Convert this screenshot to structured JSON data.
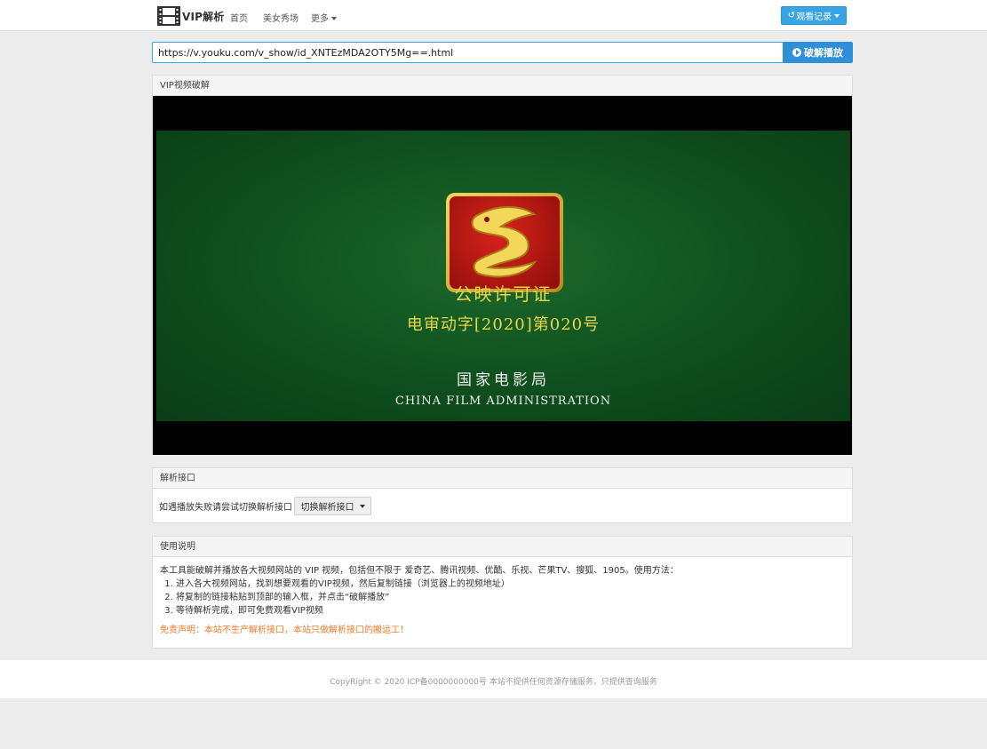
{
  "navbar": {
    "brand": "VIP解析",
    "links": [
      "首页",
      "美女秀场"
    ],
    "more": "更多",
    "history_button": "观看记录"
  },
  "search": {
    "url_value": "https://v.youku.com/v_show/id_XNTEzMDA2OTY5Mg==.html",
    "play_button": "破解播放"
  },
  "video_panel": {
    "title": "VIP视频破解",
    "frame_text": {
      "line1": "公映许可证",
      "line2": "电审动字[2020]第020号",
      "line3": "国家电影局",
      "line4": "CHINA FILM ADMINISTRATION"
    }
  },
  "api_panel": {
    "title": "解析接口",
    "hint": "如遇播放失败请尝试切换解析接口",
    "switch_button": "切换解析接口"
  },
  "help_panel": {
    "title": "使用说明",
    "intro": "本工具能破解并播放各大视频网站的 VIP 视频，包括但不限于 爱奇艺、腾讯视频、优酷、乐视、芒果TV、搜狐、1905。使用方法：",
    "steps": [
      "进入各大视频网站，找到想要观看的VIP视频，然后复制链接（浏览器上的视频地址）",
      "将复制的链接粘贴到顶部的输入框，并点击“破解播放”",
      "等待解析完成，即可免费观看VIP视频"
    ],
    "disclaimer": "免责声明：本站不生产解析接口，本站只做解析接口的搬运工！"
  },
  "footer": {
    "text": "CopyRight © 2020    ICP备0000000000号    本站不提供任何资源存储服务，只提供查询服务"
  },
  "colors": {
    "accent": "#39a4e4",
    "play_button": "#2f8fd8",
    "disclaimer": "#f07a2b",
    "film_green": "#0f4f1e"
  }
}
